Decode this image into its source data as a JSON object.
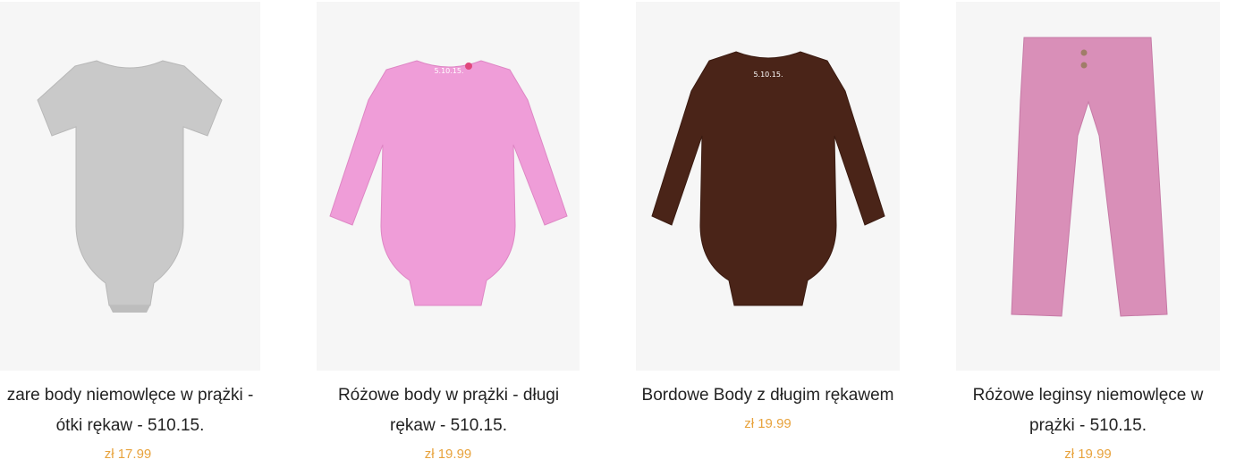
{
  "products": [
    {
      "title_line1": "zare body niemowlęce w prążki -",
      "title_line2": "ótki rękaw - 510.15.",
      "price": "zł 17.99",
      "image": "grey-short-sleeve-bodysuit",
      "color": "#cfcfcf"
    },
    {
      "title_line1": "Różowe body w prążki - długi",
      "title_line2": "rękaw - 510.15.",
      "price": "zł 19.99",
      "image": "pink-long-sleeve-bodysuit",
      "color": "#ef9dd8"
    },
    {
      "title_line1": "Bordowe Body z długim rękawem",
      "title_line2": "",
      "price": "zł 19.99",
      "image": "brown-long-sleeve-bodysuit",
      "color": "#4a2418"
    },
    {
      "title_line1": "Różowe leginsy niemowlęce w",
      "title_line2": "prążki - 510.15.",
      "price": "zł 19.99",
      "image": "pink-leggings",
      "color": "#d98fb8"
    }
  ],
  "accent_color": "#e8a33d"
}
